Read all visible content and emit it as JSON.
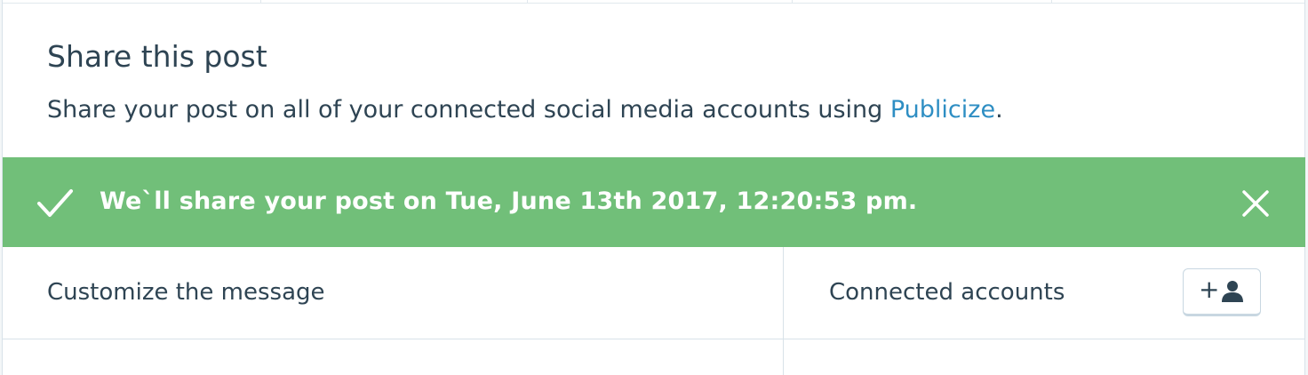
{
  "share": {
    "title": "Share this post",
    "description_prefix": "Share your post on all of your connected social media accounts using ",
    "description_link": "Publicize",
    "description_suffix": "."
  },
  "notice": {
    "message": "We`ll share your post on Tue, June 13th 2017, 12:20:53 pm.",
    "color": "#71bf79",
    "icon": "checkmark-icon",
    "close_icon": "close-icon"
  },
  "sections": {
    "customize_label": "Customize the message",
    "connected_label": "Connected accounts",
    "add_account_plus": "+",
    "add_account_icon": "person-icon"
  },
  "colors": {
    "text": "#2e4453",
    "link": "#2e8ec3",
    "border": "#d8e2e9"
  }
}
